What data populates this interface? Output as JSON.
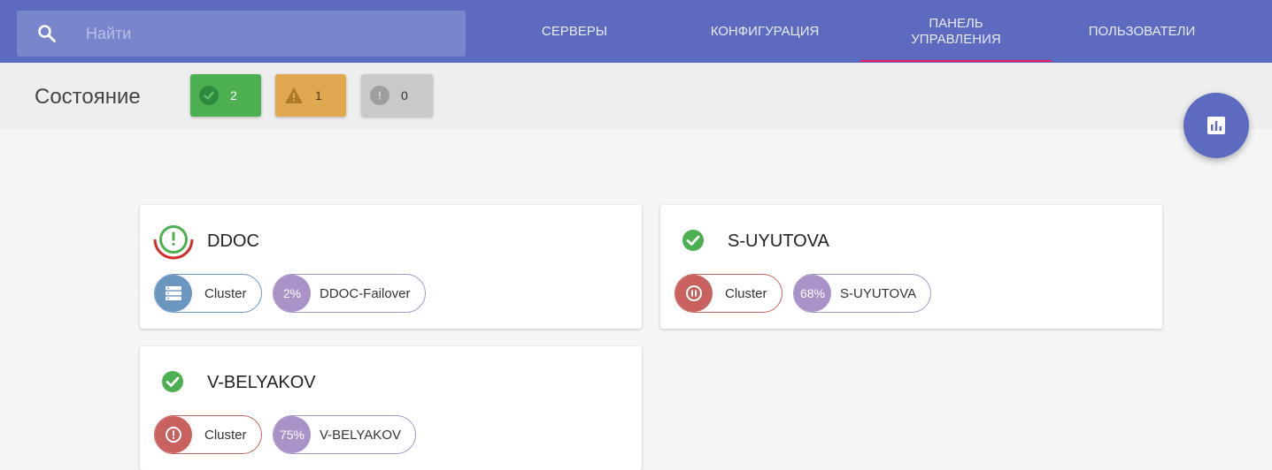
{
  "search": {
    "placeholder": "Найти"
  },
  "nav": {
    "tabs": [
      {
        "label": "СЕРВЕРЫ"
      },
      {
        "label": "КОНФИГУРАЦИЯ"
      },
      {
        "label": "ПАНЕЛЬ\nУПРАВЛЕНИЯ",
        "active": true
      },
      {
        "label": "ПОЛЬЗОВАТЕЛИ"
      }
    ]
  },
  "status": {
    "title": "Состояние",
    "ok_count": "2",
    "warning_count": "1",
    "error_count": "0"
  },
  "colors": {
    "primary": "#5c6bc0",
    "accent": "#e91e63",
    "ok": "#4caf50",
    "warning": "#e0a850",
    "neutral": "#bdbdbd",
    "cluster_ok": "#6b96c0",
    "cluster_error": "#c9625f",
    "failover": "#a992c8"
  },
  "servers": [
    {
      "name": "DDOC",
      "status_icon": "error-ring-icon",
      "cluster_label": "Cluster",
      "cluster_icon": "server-list-icon",
      "failover_percent": "2%",
      "failover_label": "DDOC-Failover"
    },
    {
      "name": "S-UYUTOVA",
      "status_icon": "check-circle-icon",
      "cluster_label": "Cluster",
      "cluster_icon": "pause-circle-icon",
      "failover_percent": "68%",
      "failover_label": "S-UYUTOVA"
    },
    {
      "name": "V-BELYAKOV",
      "status_icon": "check-circle-icon",
      "cluster_label": "Cluster",
      "cluster_icon": "alert-circle-icon",
      "failover_percent": "75%",
      "failover_label": "V-BELYAKOV"
    }
  ]
}
